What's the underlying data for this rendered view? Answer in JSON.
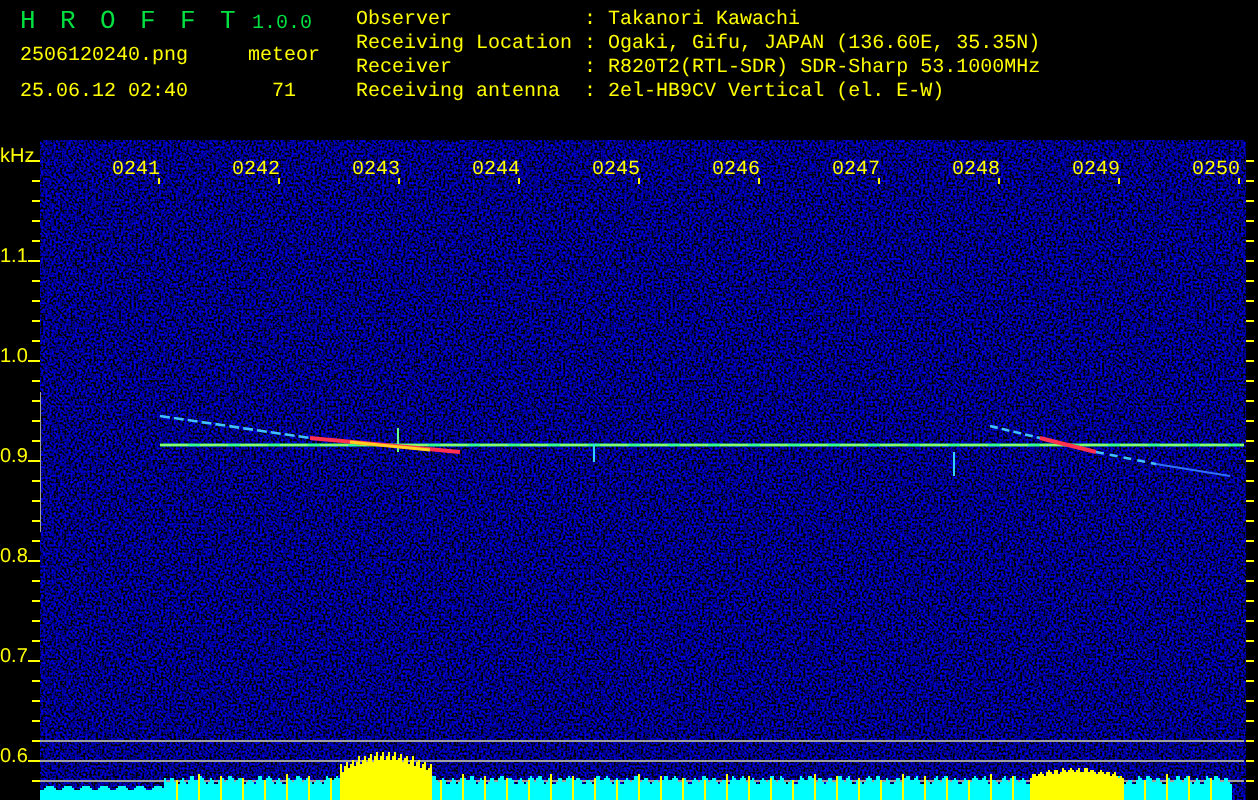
{
  "app": {
    "name": "H R O F F T",
    "version": "1.0.0"
  },
  "file": {
    "name": "2506120240.png",
    "timestamp": "25.06.12 02:40"
  },
  "meteor": {
    "label": "meteor",
    "count": "71"
  },
  "station_info": [
    {
      "label": "Observer",
      "separator": ":",
      "value": "Takanori Kawachi"
    },
    {
      "label": "Receiving Location",
      "separator": ":",
      "value": "Ogaki, Gifu, JAPAN (136.60E, 35.35N)"
    },
    {
      "label": "Receiver",
      "separator": ":",
      "value": "R820T2(RTL-SDR) SDR-Sharp 53.1000MHz"
    },
    {
      "label": "Receiving antenna",
      "separator": ":",
      "value": "2el-HB9CV Vertical (el. E-W)"
    }
  ],
  "spectrogram": {
    "y_unit": "kHz",
    "y_labels": [
      "1.1",
      "1.0",
      "0.9",
      "0.8",
      "0.7",
      "0.6"
    ],
    "time_labels": [
      "0241",
      "0242",
      "0243",
      "0244",
      "0245",
      "0246",
      "0247",
      "0248",
      "0249",
      "0250"
    ]
  }
}
